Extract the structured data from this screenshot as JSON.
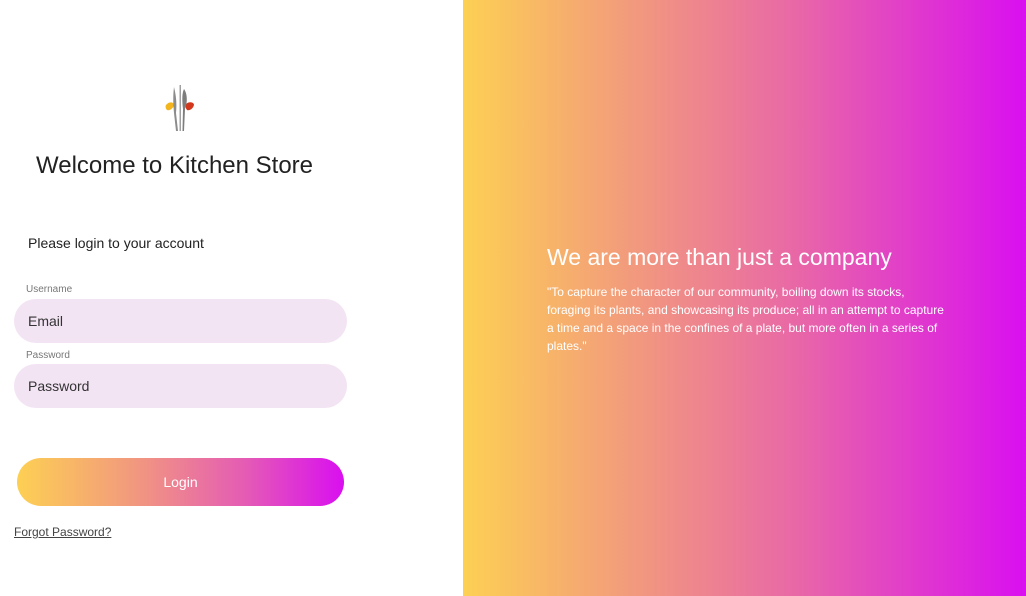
{
  "login": {
    "title": "Welcome to Kitchen Store",
    "subtitle": "Please login to your account",
    "username_label": "Username",
    "username_placeholder": "Email",
    "password_label": "Password",
    "password_placeholder": "Password",
    "login_button": "Login",
    "forgot_password": "Forgot Password?"
  },
  "promo": {
    "headline": "We are more than just a company",
    "quote": "\"To capture the character of our community, boiling down its stocks, foraging its plants, and showcasing its produce; all in an attempt to capture a time and a space in the confines of a plate, but more often in a series of plates.\""
  },
  "icons": {
    "logo": "cutlery-logo-icon"
  },
  "colors": {
    "gradient_start": "#fdd053",
    "gradient_end": "#d90ff0",
    "input_background": "#f3e4f4"
  }
}
